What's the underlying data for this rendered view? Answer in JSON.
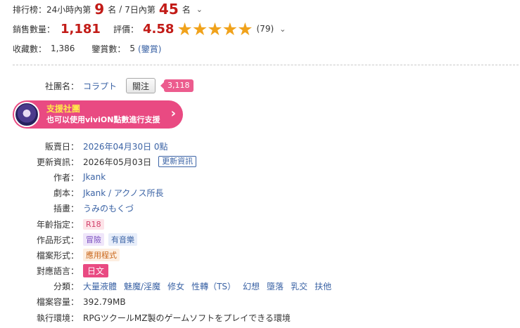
{
  "stats": {
    "rank_label": "排行榜：",
    "rank_24h_prefix": "24小時內第",
    "rank_24h_value": "9",
    "rank_24h_suffix": "名",
    "rank_sep": "/",
    "rank_7d_prefix": "7日內第",
    "rank_7d_value": "45",
    "rank_7d_suffix": "名",
    "sales_label": "銷售數量：",
    "sales_value": "1,181",
    "rating_label": "評價：",
    "rating_value": "4.58",
    "rating_stars": 4.58,
    "review_count": "(79)",
    "favorites_label": "收藏數：",
    "favorites_value": "1,386",
    "appraisal_label": "鑒賞數：",
    "appraisal_value": "5",
    "appraisal_link": "(鑒賞)"
  },
  "circle": {
    "label": "社團名：",
    "name": "コラプト",
    "follow_button": "關注",
    "follower_count": "3,118"
  },
  "support_banner": {
    "title": "支援社團",
    "subtitle": "也可以使用viviON點數進行支援"
  },
  "details": {
    "sale_date_label": "販賣日：",
    "sale_date": "2026年04月30日 0點",
    "update_label": "更新資訊：",
    "update_date": "2026年05月03日",
    "update_link": "更新資訊",
    "author_label": "作者：",
    "author": "Jkank",
    "scenario_label": "劇本：",
    "scenario": "Jkank / アクノス所長",
    "illust_label": "插畫：",
    "illust": "うみのもくづ",
    "age_label": "年齡指定：",
    "age": "R18",
    "format_label": "作品形式：",
    "formats": [
      "冒險",
      "有音樂"
    ],
    "file_format_label": "檔案形式：",
    "file_format": "應用程式",
    "language_label": "對應語言：",
    "language": "日文",
    "genre_label": "分類：",
    "genres": [
      "大量液體",
      "魅魔/淫魔",
      "修女",
      "性轉（TS）",
      "幻想",
      "墮落",
      "乳交",
      "扶他"
    ],
    "size_label": "檔案容量：",
    "size": "392.79MB",
    "env_label": "執行環境：",
    "env": "RPGツクールMZ製のゲームソフトをプレイできる環境"
  },
  "colors": {
    "accent_red": "#c21b17",
    "pink": "#e94a82",
    "star": "#f0a21b",
    "link": "#3b63a5"
  }
}
